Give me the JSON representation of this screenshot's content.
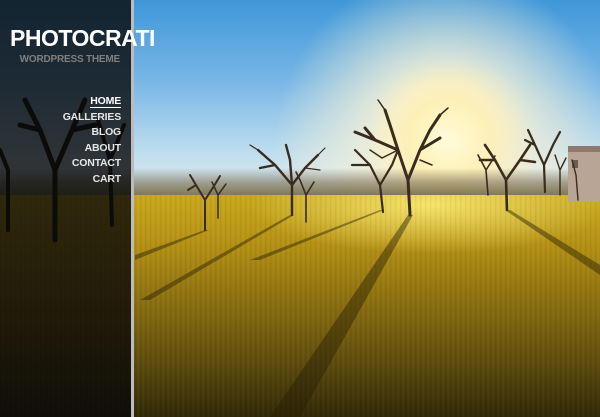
{
  "site": {
    "logo": "PHOTOCRATI",
    "tagline": "WORDPRESS THEME"
  },
  "nav": {
    "items": [
      {
        "label": "HOME",
        "active": true
      },
      {
        "label": "GALLERIES",
        "active": false
      },
      {
        "label": "BLOG",
        "active": false
      },
      {
        "label": "ABOUT",
        "active": false
      },
      {
        "label": "CONTACT",
        "active": false
      },
      {
        "label": "CART",
        "active": false
      }
    ]
  },
  "colors": {
    "sidebar_bg": "#080808",
    "sidebar_edge": "#bcbcbc",
    "nav_text": "#e6e6e6",
    "tagline_text": "#7f7f7f"
  }
}
